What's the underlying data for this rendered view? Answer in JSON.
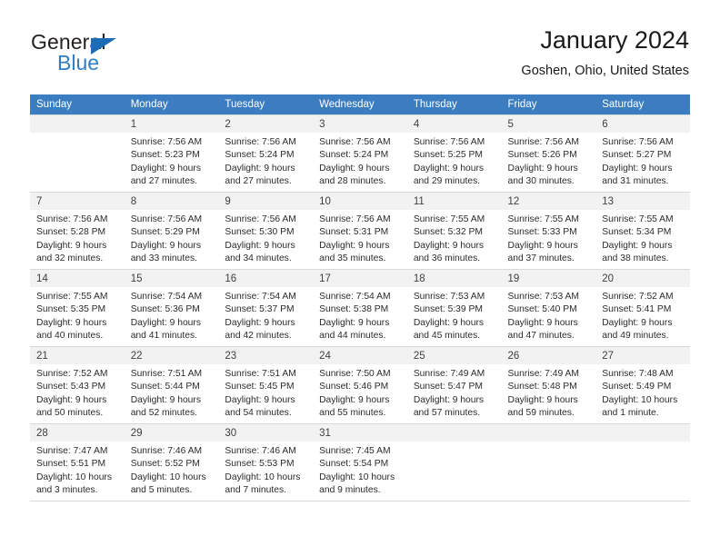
{
  "brand": {
    "name_part1": "General",
    "name_part2": "Blue",
    "accent_color": "#2e7ec4",
    "triangle_color": "#1b6cb4"
  },
  "header": {
    "title": "January 2024",
    "subtitle": "Goshen, Ohio, United States"
  },
  "calendar": {
    "header_bg": "#3b7dc0",
    "weekdays": [
      "Sunday",
      "Monday",
      "Tuesday",
      "Wednesday",
      "Thursday",
      "Friday",
      "Saturday"
    ],
    "weeks": [
      [
        {
          "day": "",
          "lines": []
        },
        {
          "day": "1",
          "lines": [
            "Sunrise: 7:56 AM",
            "Sunset: 5:23 PM",
            "Daylight: 9 hours",
            "and 27 minutes."
          ]
        },
        {
          "day": "2",
          "lines": [
            "Sunrise: 7:56 AM",
            "Sunset: 5:24 PM",
            "Daylight: 9 hours",
            "and 27 minutes."
          ]
        },
        {
          "day": "3",
          "lines": [
            "Sunrise: 7:56 AM",
            "Sunset: 5:24 PM",
            "Daylight: 9 hours",
            "and 28 minutes."
          ]
        },
        {
          "day": "4",
          "lines": [
            "Sunrise: 7:56 AM",
            "Sunset: 5:25 PM",
            "Daylight: 9 hours",
            "and 29 minutes."
          ]
        },
        {
          "day": "5",
          "lines": [
            "Sunrise: 7:56 AM",
            "Sunset: 5:26 PM",
            "Daylight: 9 hours",
            "and 30 minutes."
          ]
        },
        {
          "day": "6",
          "lines": [
            "Sunrise: 7:56 AM",
            "Sunset: 5:27 PM",
            "Daylight: 9 hours",
            "and 31 minutes."
          ]
        }
      ],
      [
        {
          "day": "7",
          "lines": [
            "Sunrise: 7:56 AM",
            "Sunset: 5:28 PM",
            "Daylight: 9 hours",
            "and 32 minutes."
          ]
        },
        {
          "day": "8",
          "lines": [
            "Sunrise: 7:56 AM",
            "Sunset: 5:29 PM",
            "Daylight: 9 hours",
            "and 33 minutes."
          ]
        },
        {
          "day": "9",
          "lines": [
            "Sunrise: 7:56 AM",
            "Sunset: 5:30 PM",
            "Daylight: 9 hours",
            "and 34 minutes."
          ]
        },
        {
          "day": "10",
          "lines": [
            "Sunrise: 7:56 AM",
            "Sunset: 5:31 PM",
            "Daylight: 9 hours",
            "and 35 minutes."
          ]
        },
        {
          "day": "11",
          "lines": [
            "Sunrise: 7:55 AM",
            "Sunset: 5:32 PM",
            "Daylight: 9 hours",
            "and 36 minutes."
          ]
        },
        {
          "day": "12",
          "lines": [
            "Sunrise: 7:55 AM",
            "Sunset: 5:33 PM",
            "Daylight: 9 hours",
            "and 37 minutes."
          ]
        },
        {
          "day": "13",
          "lines": [
            "Sunrise: 7:55 AM",
            "Sunset: 5:34 PM",
            "Daylight: 9 hours",
            "and 38 minutes."
          ]
        }
      ],
      [
        {
          "day": "14",
          "lines": [
            "Sunrise: 7:55 AM",
            "Sunset: 5:35 PM",
            "Daylight: 9 hours",
            "and 40 minutes."
          ]
        },
        {
          "day": "15",
          "lines": [
            "Sunrise: 7:54 AM",
            "Sunset: 5:36 PM",
            "Daylight: 9 hours",
            "and 41 minutes."
          ]
        },
        {
          "day": "16",
          "lines": [
            "Sunrise: 7:54 AM",
            "Sunset: 5:37 PM",
            "Daylight: 9 hours",
            "and 42 minutes."
          ]
        },
        {
          "day": "17",
          "lines": [
            "Sunrise: 7:54 AM",
            "Sunset: 5:38 PM",
            "Daylight: 9 hours",
            "and 44 minutes."
          ]
        },
        {
          "day": "18",
          "lines": [
            "Sunrise: 7:53 AM",
            "Sunset: 5:39 PM",
            "Daylight: 9 hours",
            "and 45 minutes."
          ]
        },
        {
          "day": "19",
          "lines": [
            "Sunrise: 7:53 AM",
            "Sunset: 5:40 PM",
            "Daylight: 9 hours",
            "and 47 minutes."
          ]
        },
        {
          "day": "20",
          "lines": [
            "Sunrise: 7:52 AM",
            "Sunset: 5:41 PM",
            "Daylight: 9 hours",
            "and 49 minutes."
          ]
        }
      ],
      [
        {
          "day": "21",
          "lines": [
            "Sunrise: 7:52 AM",
            "Sunset: 5:43 PM",
            "Daylight: 9 hours",
            "and 50 minutes."
          ]
        },
        {
          "day": "22",
          "lines": [
            "Sunrise: 7:51 AM",
            "Sunset: 5:44 PM",
            "Daylight: 9 hours",
            "and 52 minutes."
          ]
        },
        {
          "day": "23",
          "lines": [
            "Sunrise: 7:51 AM",
            "Sunset: 5:45 PM",
            "Daylight: 9 hours",
            "and 54 minutes."
          ]
        },
        {
          "day": "24",
          "lines": [
            "Sunrise: 7:50 AM",
            "Sunset: 5:46 PM",
            "Daylight: 9 hours",
            "and 55 minutes."
          ]
        },
        {
          "day": "25",
          "lines": [
            "Sunrise: 7:49 AM",
            "Sunset: 5:47 PM",
            "Daylight: 9 hours",
            "and 57 minutes."
          ]
        },
        {
          "day": "26",
          "lines": [
            "Sunrise: 7:49 AM",
            "Sunset: 5:48 PM",
            "Daylight: 9 hours",
            "and 59 minutes."
          ]
        },
        {
          "day": "27",
          "lines": [
            "Sunrise: 7:48 AM",
            "Sunset: 5:49 PM",
            "Daylight: 10 hours",
            "and 1 minute."
          ]
        }
      ],
      [
        {
          "day": "28",
          "lines": [
            "Sunrise: 7:47 AM",
            "Sunset: 5:51 PM",
            "Daylight: 10 hours",
            "and 3 minutes."
          ]
        },
        {
          "day": "29",
          "lines": [
            "Sunrise: 7:46 AM",
            "Sunset: 5:52 PM",
            "Daylight: 10 hours",
            "and 5 minutes."
          ]
        },
        {
          "day": "30",
          "lines": [
            "Sunrise: 7:46 AM",
            "Sunset: 5:53 PM",
            "Daylight: 10 hours",
            "and 7 minutes."
          ]
        },
        {
          "day": "31",
          "lines": [
            "Sunrise: 7:45 AM",
            "Sunset: 5:54 PM",
            "Daylight: 10 hours",
            "and 9 minutes."
          ]
        },
        {
          "day": "",
          "lines": []
        },
        {
          "day": "",
          "lines": []
        },
        {
          "day": "",
          "lines": []
        }
      ]
    ]
  }
}
